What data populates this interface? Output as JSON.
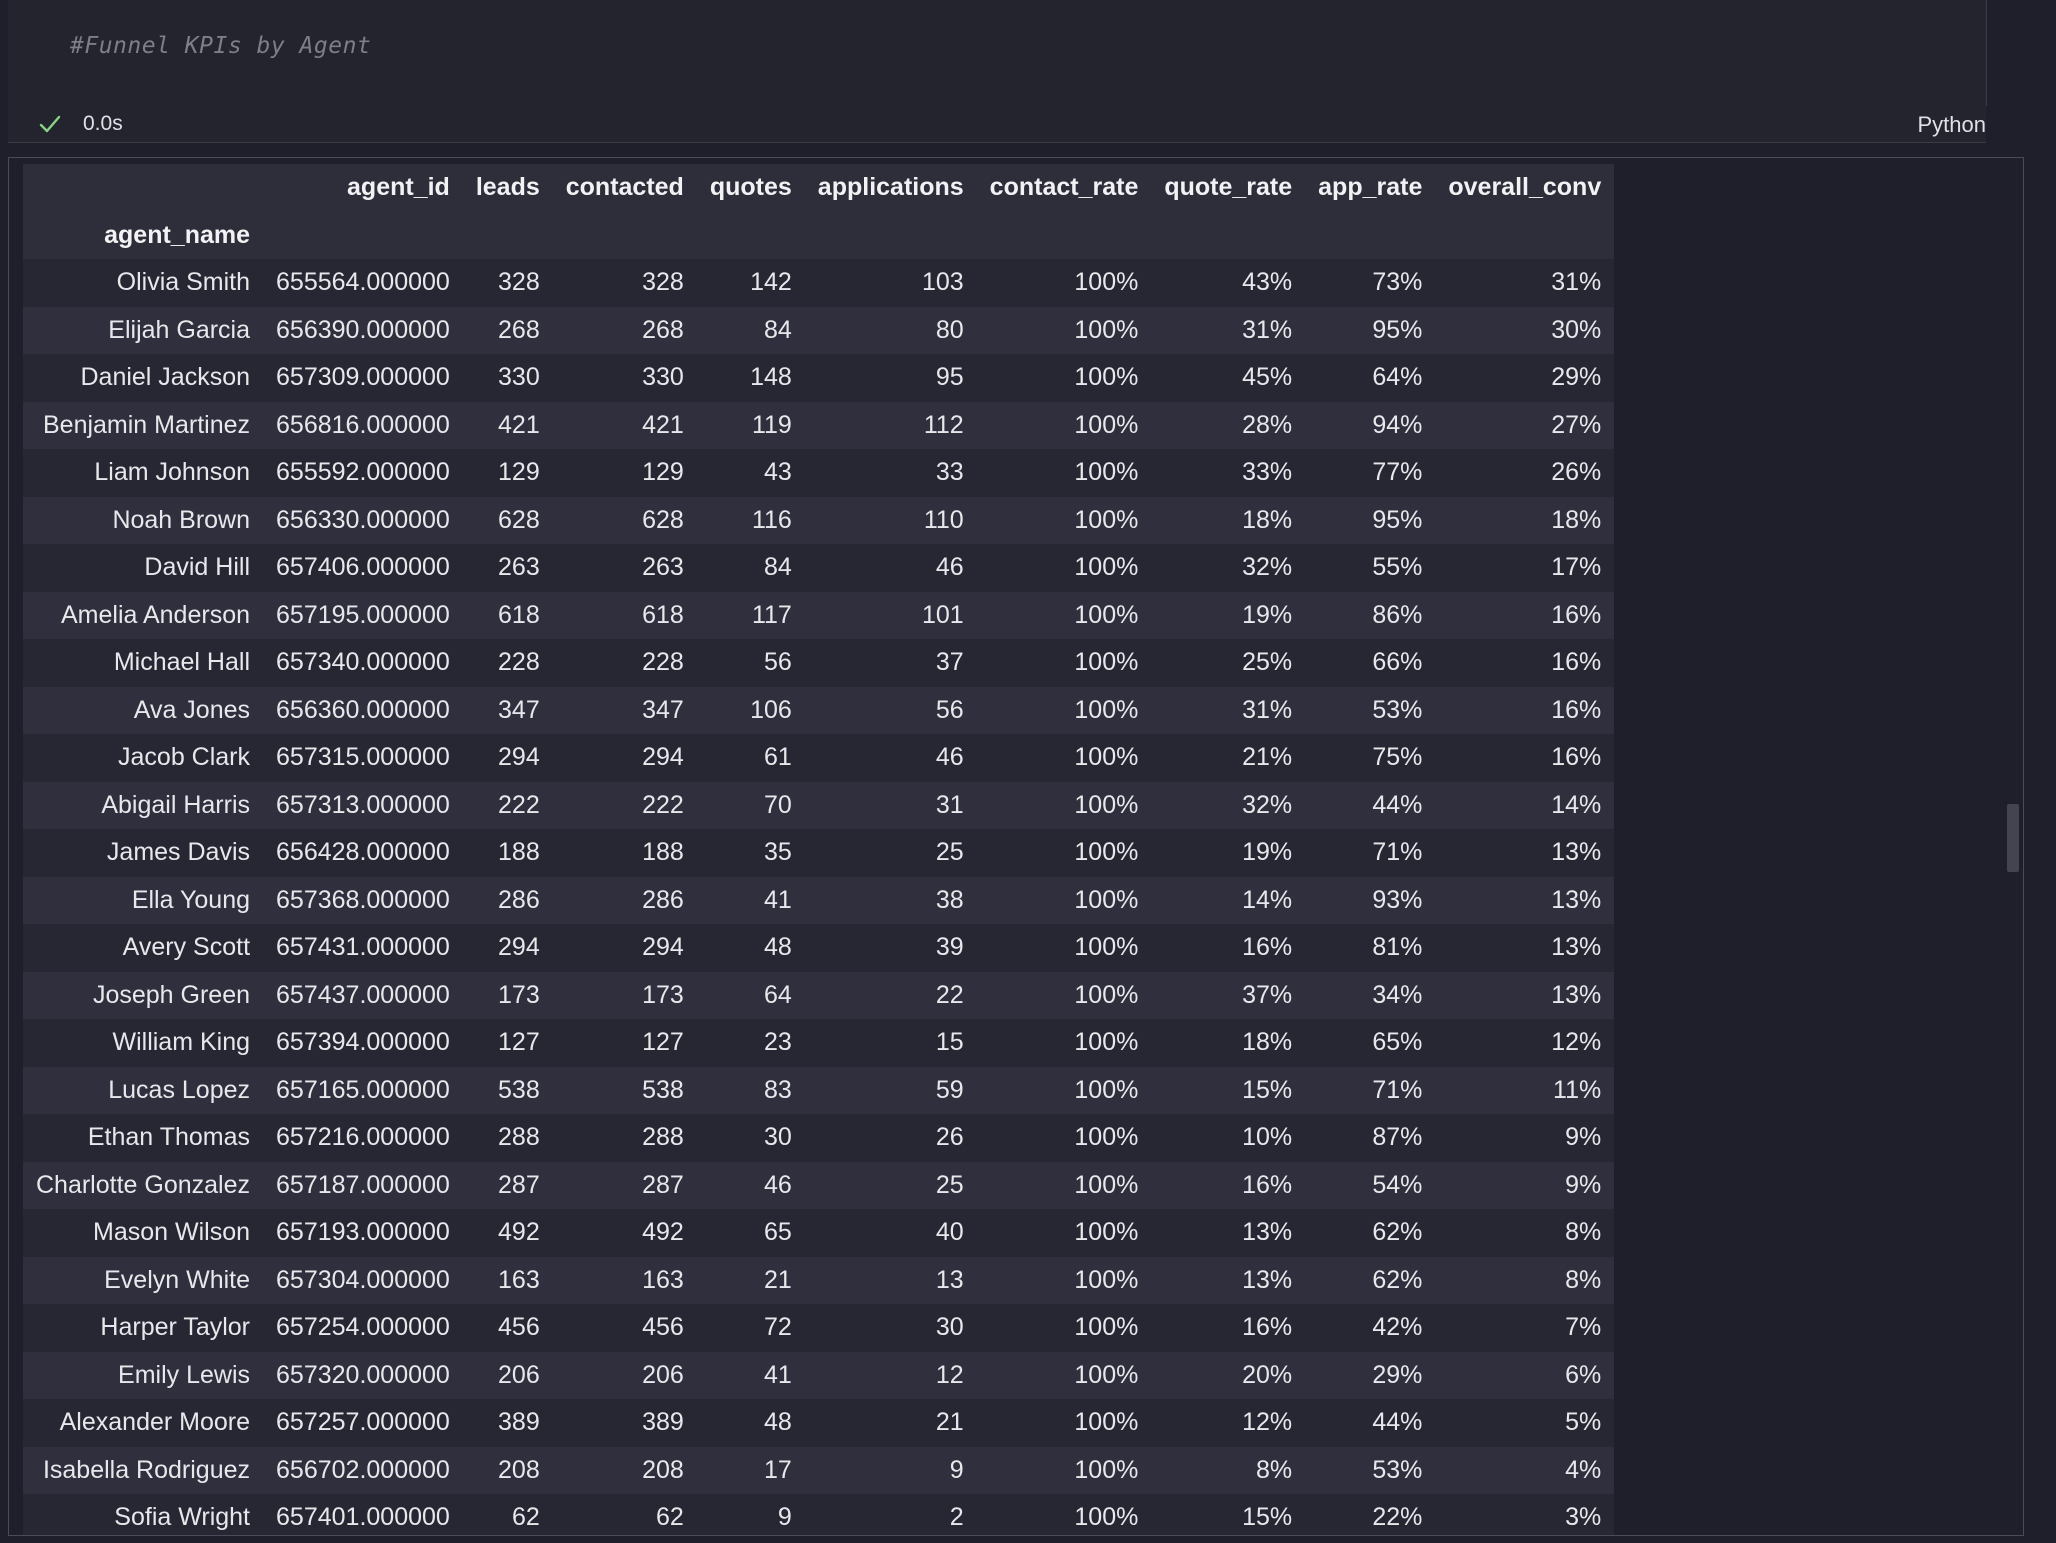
{
  "cell": {
    "code": "#Funnel KPIs by Agent",
    "status_time": "0.0s",
    "language": "Python"
  },
  "table": {
    "columns": [
      "agent_id",
      "leads",
      "contacted",
      "quotes",
      "applications",
      "contact_rate",
      "quote_rate",
      "app_rate",
      "overall_conv"
    ],
    "index_name": "agent_name",
    "rows": [
      [
        "Olivia Smith",
        "655564.000000",
        "328",
        "328",
        "142",
        "103",
        "100%",
        "43%",
        "73%",
        "31%"
      ],
      [
        "Elijah Garcia",
        "656390.000000",
        "268",
        "268",
        "84",
        "80",
        "100%",
        "31%",
        "95%",
        "30%"
      ],
      [
        "Daniel Jackson",
        "657309.000000",
        "330",
        "330",
        "148",
        "95",
        "100%",
        "45%",
        "64%",
        "29%"
      ],
      [
        "Benjamin Martinez",
        "656816.000000",
        "421",
        "421",
        "119",
        "112",
        "100%",
        "28%",
        "94%",
        "27%"
      ],
      [
        "Liam Johnson",
        "655592.000000",
        "129",
        "129",
        "43",
        "33",
        "100%",
        "33%",
        "77%",
        "26%"
      ],
      [
        "Noah Brown",
        "656330.000000",
        "628",
        "628",
        "116",
        "110",
        "100%",
        "18%",
        "95%",
        "18%"
      ],
      [
        "David Hill",
        "657406.000000",
        "263",
        "263",
        "84",
        "46",
        "100%",
        "32%",
        "55%",
        "17%"
      ],
      [
        "Amelia Anderson",
        "657195.000000",
        "618",
        "618",
        "117",
        "101",
        "100%",
        "19%",
        "86%",
        "16%"
      ],
      [
        "Michael Hall",
        "657340.000000",
        "228",
        "228",
        "56",
        "37",
        "100%",
        "25%",
        "66%",
        "16%"
      ],
      [
        "Ava Jones",
        "656360.000000",
        "347",
        "347",
        "106",
        "56",
        "100%",
        "31%",
        "53%",
        "16%"
      ],
      [
        "Jacob Clark",
        "657315.000000",
        "294",
        "294",
        "61",
        "46",
        "100%",
        "21%",
        "75%",
        "16%"
      ],
      [
        "Abigail Harris",
        "657313.000000",
        "222",
        "222",
        "70",
        "31",
        "100%",
        "32%",
        "44%",
        "14%"
      ],
      [
        "James Davis",
        "656428.000000",
        "188",
        "188",
        "35",
        "25",
        "100%",
        "19%",
        "71%",
        "13%"
      ],
      [
        "Ella Young",
        "657368.000000",
        "286",
        "286",
        "41",
        "38",
        "100%",
        "14%",
        "93%",
        "13%"
      ],
      [
        "Avery Scott",
        "657431.000000",
        "294",
        "294",
        "48",
        "39",
        "100%",
        "16%",
        "81%",
        "13%"
      ],
      [
        "Joseph Green",
        "657437.000000",
        "173",
        "173",
        "64",
        "22",
        "100%",
        "37%",
        "34%",
        "13%"
      ],
      [
        "William King",
        "657394.000000",
        "127",
        "127",
        "23",
        "15",
        "100%",
        "18%",
        "65%",
        "12%"
      ],
      [
        "Lucas Lopez",
        "657165.000000",
        "538",
        "538",
        "83",
        "59",
        "100%",
        "15%",
        "71%",
        "11%"
      ],
      [
        "Ethan Thomas",
        "657216.000000",
        "288",
        "288",
        "30",
        "26",
        "100%",
        "10%",
        "87%",
        "9%"
      ],
      [
        "Charlotte Gonzalez",
        "657187.000000",
        "287",
        "287",
        "46",
        "25",
        "100%",
        "16%",
        "54%",
        "9%"
      ],
      [
        "Mason Wilson",
        "657193.000000",
        "492",
        "492",
        "65",
        "40",
        "100%",
        "13%",
        "62%",
        "8%"
      ],
      [
        "Evelyn White",
        "657304.000000",
        "163",
        "163",
        "21",
        "13",
        "100%",
        "13%",
        "62%",
        "8%"
      ],
      [
        "Harper Taylor",
        "657254.000000",
        "456",
        "456",
        "72",
        "30",
        "100%",
        "16%",
        "42%",
        "7%"
      ],
      [
        "Emily Lewis",
        "657320.000000",
        "206",
        "206",
        "41",
        "12",
        "100%",
        "20%",
        "29%",
        "6%"
      ],
      [
        "Alexander Moore",
        "657257.000000",
        "389",
        "389",
        "48",
        "21",
        "100%",
        "12%",
        "44%",
        "5%"
      ],
      [
        "Isabella Rodriguez",
        "656702.000000",
        "208",
        "208",
        "17",
        "9",
        "100%",
        "8%",
        "53%",
        "4%"
      ],
      [
        "Sofia Wright",
        "657401.000000",
        "62",
        "62",
        "9",
        "2",
        "100%",
        "15%",
        "22%",
        "3%"
      ]
    ]
  },
  "icons": {
    "status": "checkmark-icon"
  },
  "colors": {
    "background": "#1f1f2b",
    "success": "#89d185",
    "comment": "#7d7f86"
  }
}
